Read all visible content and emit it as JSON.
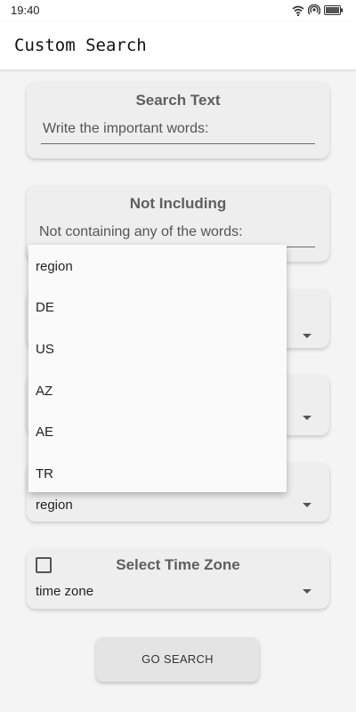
{
  "status_bar": {
    "time": "19:40",
    "icons": [
      "wifi-icon",
      "hotspot-icon",
      "battery-icon"
    ]
  },
  "app_bar": {
    "title": "Custom Search"
  },
  "search_text_card": {
    "title": "Search Text",
    "placeholder": "Write the important words:"
  },
  "not_including_card": {
    "title": "Not Including",
    "placeholder": "Not containing any of the words:"
  },
  "region_card": {
    "selected_value": "region"
  },
  "time_zone_card": {
    "title": "Select Time Zone",
    "selected_value": "time zone",
    "checked": false
  },
  "dropdown": {
    "options": [
      "region",
      "DE",
      "US",
      "AZ",
      "AE",
      "TR"
    ]
  },
  "go_search_label": "GO SEARCH"
}
